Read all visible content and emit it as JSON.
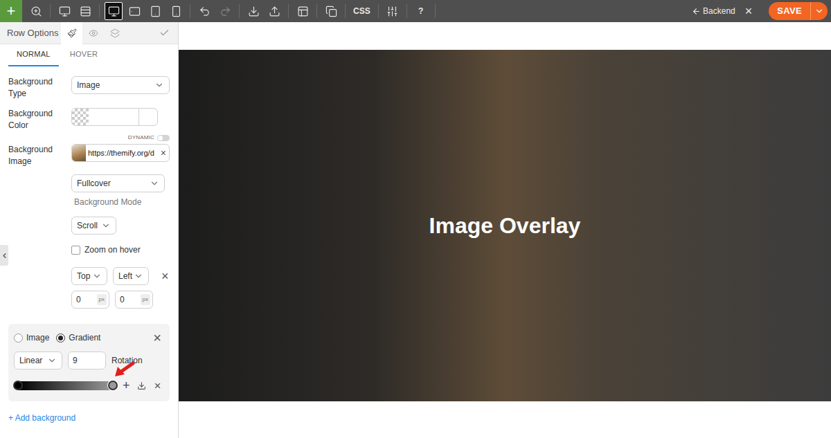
{
  "toolbar": {
    "add": "+",
    "groups": [
      [
        {
          "kind": "zoom",
          "label": "",
          "selected": false,
          "disabled": false
        }
      ],
      [
        {
          "kind": "preview",
          "label": "",
          "selected": false,
          "disabled": false
        },
        {
          "kind": "layers",
          "label": "",
          "selected": false,
          "disabled": false
        }
      ],
      [
        {
          "kind": "desktop",
          "label": "",
          "selected": true,
          "disabled": false
        },
        {
          "kind": "tabletlandscape",
          "label": "",
          "selected": false,
          "disabled": false
        },
        {
          "kind": "tablet",
          "label": "",
          "selected": false,
          "disabled": false
        },
        {
          "kind": "mobile",
          "label": "",
          "selected": false,
          "disabled": false
        }
      ],
      [
        {
          "kind": "undo",
          "label": "",
          "selected": false,
          "disabled": false
        },
        {
          "kind": "redo",
          "label": "",
          "selected": false,
          "disabled": true
        }
      ],
      [
        {
          "kind": "import",
          "label": "",
          "selected": false,
          "disabled": false
        },
        {
          "kind": "export",
          "label": "",
          "selected": false,
          "disabled": false
        }
      ],
      [
        {
          "kind": "layout",
          "label": "",
          "selected": false,
          "disabled": false
        }
      ],
      [
        {
          "kind": "duplicate",
          "label": "",
          "selected": false,
          "disabled": false
        }
      ],
      [
        {
          "kind": "css",
          "label": "CSS",
          "selected": false,
          "disabled": false
        }
      ],
      [
        {
          "kind": "sliders",
          "label": "",
          "selected": false,
          "disabled": false
        }
      ],
      [
        {
          "kind": "help",
          "label": "?",
          "selected": false,
          "disabled": false
        }
      ]
    ],
    "backend": "Backend",
    "close": "×",
    "save": "SAVE"
  },
  "panel": {
    "title": "Row Options",
    "tabs": [
      {
        "kind": "style",
        "selected": true
      },
      {
        "kind": "visibility",
        "selected": false
      },
      {
        "kind": "animation",
        "selected": false
      }
    ],
    "modes": [
      {
        "label": "NORMAL",
        "selected": true
      },
      {
        "label": "HOVER",
        "selected": false
      }
    ],
    "background_type": {
      "label": "Background Type",
      "value": "Image"
    },
    "background_color": {
      "label": "Background Color",
      "value": ""
    },
    "dynamic": {
      "label": "DYNAMIC",
      "on": false
    },
    "background_image": {
      "label": "Background Image",
      "value": "https://themify.org/d",
      "clear": "×"
    },
    "background_mode": {
      "value": "Fullcover",
      "hint": "Background Mode"
    },
    "attachment": {
      "value": "Scroll"
    },
    "zoom_on_hover": {
      "label": "Zoom on hover",
      "checked": false
    },
    "position": {
      "vertical": "Top",
      "horizontal": "Left",
      "clear": "×"
    },
    "offsets": [
      {
        "value": "0",
        "unit": "px"
      },
      {
        "value": "0",
        "unit": "px"
      }
    ],
    "overlay": {
      "types": [
        {
          "label": "Image",
          "selected": false
        },
        {
          "label": "Gradient",
          "selected": true
        }
      ],
      "close": "×",
      "gradient_type": "Linear",
      "rotation": {
        "value": "9",
        "label": "Rotation"
      },
      "stops": [
        {
          "level": 0,
          "color": "#000000",
          "selected": false
        },
        {
          "level": 1,
          "color": "#9a9a9a",
          "selected": true
        }
      ],
      "add": "+",
      "remove": "×"
    },
    "add_background": "+ Add background"
  },
  "canvas": {
    "heading": "Image Overlay"
  }
}
